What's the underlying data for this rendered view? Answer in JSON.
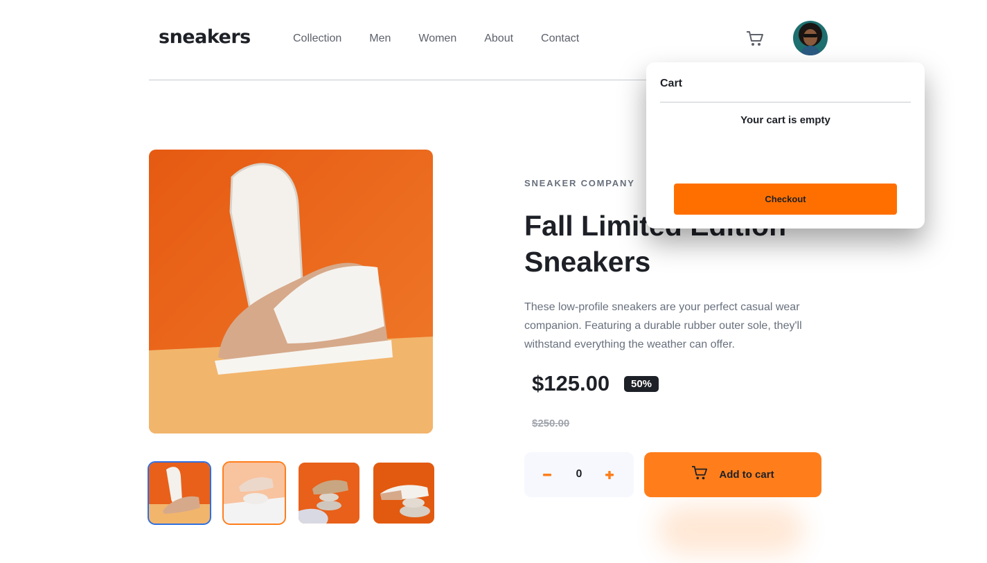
{
  "brand": {
    "logo": "sneakers"
  },
  "nav": {
    "items": [
      "Collection",
      "Men",
      "Women",
      "About",
      "Contact"
    ]
  },
  "product": {
    "company": "SNEAKER COMPANY",
    "title": "Fall Limited Edition Sneakers",
    "description": "These low-profile sneakers are your perfect casual wear companion. Featuring a durable rubber outer sole, they'll withstand everything the weather can offer.",
    "price": "$125.00",
    "discount": "50%",
    "old_price": "$250.00",
    "quantity": "0",
    "add_to_cart_label": "Add to cart"
  },
  "cart": {
    "title": "Cart",
    "empty_text": "Your cart is empty",
    "checkout_label": "Checkout"
  },
  "colors": {
    "accent": "#ff7e1b",
    "dark": "#1d2026",
    "muted": "#68707d"
  },
  "icons": [
    "cart-icon",
    "avatar",
    "minus-icon",
    "plus-icon"
  ]
}
